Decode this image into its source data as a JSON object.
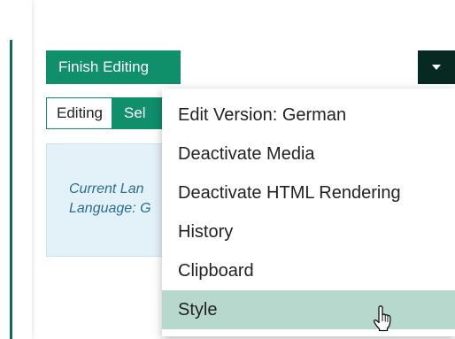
{
  "toolbar": {
    "finish_label": "Finish Editing",
    "dropdown_icon": "caret-down-icon"
  },
  "mode": {
    "editing_label": "Editing",
    "select_label": "Sel"
  },
  "info": {
    "line1": "Current Lan",
    "line2": "Language: G"
  },
  "menu": {
    "items": [
      {
        "label": "Edit Version: German"
      },
      {
        "label": "Deactivate Media"
      },
      {
        "label": "Deactivate HTML Rendering"
      },
      {
        "label": "History"
      },
      {
        "label": "Clipboard"
      },
      {
        "label": "Style"
      }
    ],
    "active_item": "Style"
  },
  "colors": {
    "accent": "#0f8f6a",
    "dropdown_button": "#062a22",
    "active_item": "#b7d8cc",
    "info_background": "#e3f1f9",
    "info_text": "#2a6d96"
  }
}
